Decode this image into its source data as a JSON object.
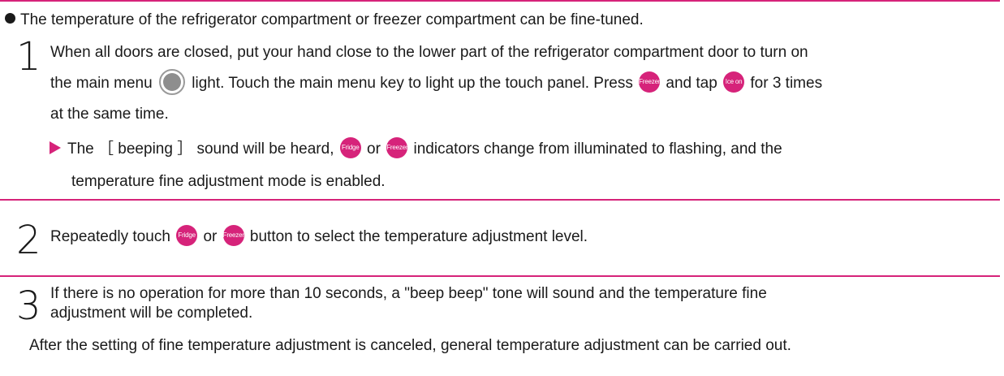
{
  "intro": "The temperature of the refrigerator compartment or freezer compartment can be fine-tuned.",
  "steps": [
    {
      "number": "1",
      "line1": "When all doors are closed, put your hand close to the lower part of the refrigerator compartment door to turn on",
      "line2_a": "the main menu",
      "line2_b": "light. Touch the main menu key to light up the touch panel. Press",
      "line2_c": "and tap",
      "line2_d": "for 3 times",
      "line3": "at the same time.",
      "result_a": "The ［ beeping ］ sound will be heard,",
      "result_b": "or",
      "result_c": "indicators change from illuminated to flashing, and the",
      "result_line2": "temperature fine adjustment mode is enabled."
    },
    {
      "number": "2",
      "text_a": "Repeatedly touch",
      "text_b": "or",
      "text_c": "button to select the temperature adjustment level."
    },
    {
      "number": "3",
      "line1": "If there is no operation for more than 10 seconds, a \"beep beep\" tone will sound and the temperature fine",
      "line2": "adjustment will be completed.",
      "note": "After the setting of fine temperature adjustment is canceled, general temperature adjustment can be carried out."
    }
  ],
  "buttons": {
    "freezer": "Freezer",
    "ice_on": "Ice on",
    "fridge": "Fridge"
  },
  "colors": {
    "accent": "#d6237a",
    "icon_gray": "#8e8e8e"
  },
  "icons": {
    "main_menu": "main-menu-icon",
    "result_marker": "triangle-arrow-icon"
  }
}
